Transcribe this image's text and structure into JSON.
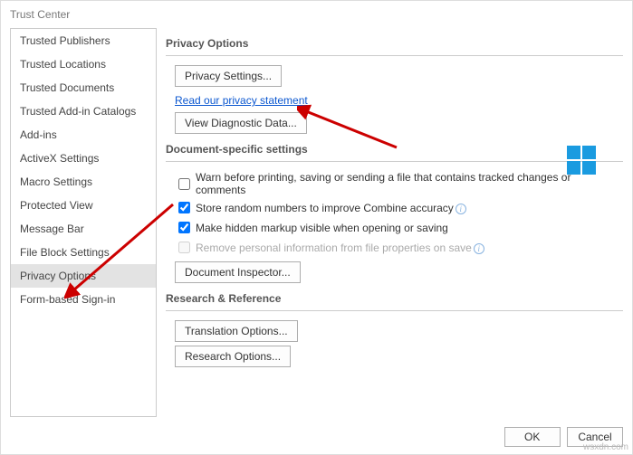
{
  "window": {
    "title": "Trust Center"
  },
  "sidebar": {
    "items": [
      "Trusted Publishers",
      "Trusted Locations",
      "Trusted Documents",
      "Trusted Add-in Catalogs",
      "Add-ins",
      "ActiveX Settings",
      "Macro Settings",
      "Protected View",
      "Message Bar",
      "File Block Settings",
      "Privacy Options",
      "Form-based Sign-in"
    ],
    "selected_index": 10
  },
  "sections": {
    "privacy": {
      "header": "Privacy Options",
      "privacy_settings_btn": "Privacy Settings...",
      "privacy_link": "Read our privacy statement",
      "diag_btn": "View Diagnostic Data..."
    },
    "doc": {
      "header": "Document-specific settings",
      "warn_label": "Warn before printing, saving or sending a file that contains tracked changes or comments",
      "store_label": "Store random numbers to improve Combine accuracy",
      "markup_label": "Make hidden markup visible when opening or saving",
      "remove_label": "Remove personal information from file properties on save",
      "inspector_btn": "Document Inspector..."
    },
    "research": {
      "header": "Research & Reference",
      "translation_btn": "Translation Options...",
      "research_btn": "Research Options..."
    }
  },
  "dialog": {
    "ok": "OK",
    "cancel": "Cancel"
  },
  "watermark": "wsxdn.com"
}
